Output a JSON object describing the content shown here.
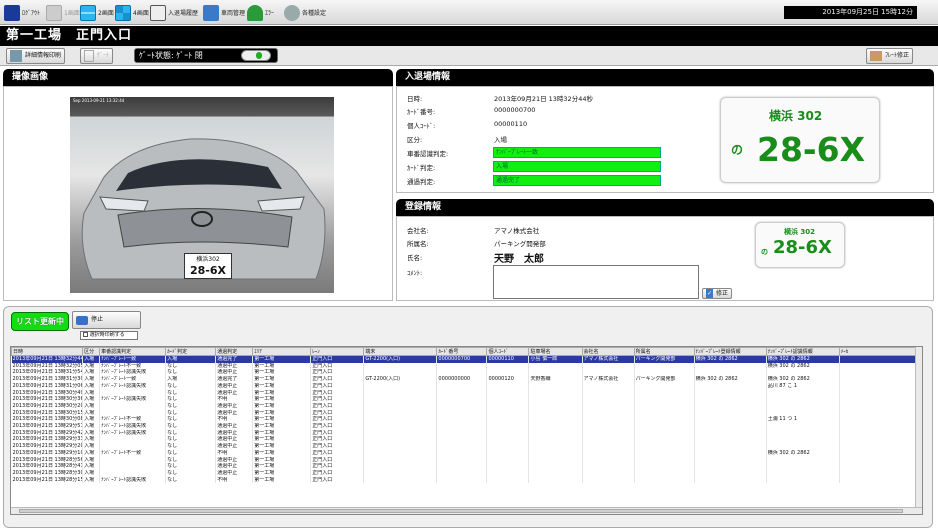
{
  "toolbar": {
    "items": [
      "ﾛｸﾞｱｳﾄ",
      "1画面",
      "2画面",
      "4画面",
      "入退場履歴",
      "車両管理",
      "ｴﾗｰ",
      "各種設定"
    ],
    "datetime": "2013年09月25日 15時12分"
  },
  "title": "第一工場　正門入口",
  "subbar": {
    "print_label": "詳細情報印刷",
    "gate_label": "ｹﾞｰﾄ",
    "gate_status": "ｹﾞｰﾄ状態:  ｹﾞｰﾄ 閉",
    "plate_fix_label": "ﾌﾚｰﾄ修正"
  },
  "camera": {
    "header": "撮像画像",
    "timestamp": "Sep 2013-09-21 13:32:44",
    "plate_top": "横浜302",
    "plate_main": "28-6X"
  },
  "entry": {
    "header": "入退場情報",
    "labels": [
      "日時:",
      "ｶｰﾄﾞ番号:",
      "個人ｺｰﾄﾞ:",
      "区分:",
      "車番認識判定:",
      "ｶｰﾄﾞ判定:",
      "通過判定:"
    ],
    "values": [
      "2013年09月21日 13時32分44秒",
      "0000000700",
      "00000110",
      "入場"
    ],
    "status": [
      "ﾅﾝﾊﾞｰﾌﾟﾚｰﾄ一致",
      "入場",
      "通過完了"
    ],
    "plate": {
      "hira": "の",
      "region": "横浜 302",
      "number": "28-6X"
    }
  },
  "registration": {
    "header": "登録情報",
    "labels": [
      "会社名:",
      "所属名:",
      "氏名:",
      "ｺﾒﾝﾄ:"
    ],
    "company": "アマノ株式会社",
    "department": "パーキング開発部",
    "name": "天野　太郎",
    "comment": "",
    "fix_button": "修正",
    "plate": {
      "hira": "の",
      "region": "横浜 302",
      "number": "28-6X"
    }
  },
  "list": {
    "refresh_button": "リスト更新中",
    "stop_button": "停止",
    "checkbox_label": "選択時印刷する",
    "columns": [
      "日時",
      "区分",
      "車番認識判定",
      "ｶｰﾄﾞ判定",
      "通過判定",
      "ｴﾘｱ",
      "ﾚｰﾝ",
      "端末",
      "ｶｰﾄﾞ番号",
      "個人ｺｰﾄﾞ",
      "駐車場名",
      "会社名",
      "所属名",
      "ﾅﾝﾊﾞｰﾌﾟﾚｰﾄ登録情報",
      "ﾅﾝﾊﾞｰﾌﾟﾚｰﾄ認識情報",
      "ﾒｰｶ"
    ],
    "rows": [
      [
        "2013年09月21日 13時32分44秒",
        "入場",
        "ﾅﾝﾊﾞｰﾌﾟﾚｰﾄ一致",
        "入場",
        "通過完了",
        "第一工場",
        "正門入口",
        "GT-2200(入口)",
        "0000000700",
        "00000110",
        "小島 慎一郎",
        "アマノ株式会社",
        "パーキング開発部",
        "横浜 302 の 2862",
        "横浜 302 の 2862",
        ""
      ],
      [
        "2013年09月21日 13時32分05秒",
        "入場",
        "ﾅﾝﾊﾞｰﾌﾟﾚｰﾄ不一致",
        "なし",
        "通過中止",
        "第一工場",
        "正門入口",
        "",
        "",
        "",
        "",
        "",
        "",
        "",
        "横浜 302 の 2862",
        ""
      ],
      [
        "2013年09月21日 13時31分54秒",
        "入場",
        "ﾅﾝﾊﾞｰﾌﾟﾚｰﾄ認識失敗",
        "なし",
        "通過中止",
        "第一工場",
        "正門入口",
        "",
        "",
        "",
        "",
        "",
        "",
        "",
        "",
        ""
      ],
      [
        "2013年09月21日 13時31分30秒",
        "入場",
        "ﾅﾝﾊﾞｰﾌﾟﾚｰﾄ一致",
        "入場",
        "通過完了",
        "第一工場",
        "正門入口",
        "GT-2200(入口)",
        "0000000000",
        "00000120",
        "天野香織",
        "アマノ株式会社",
        "パーキング開発部",
        "横浜 302 の 2862",
        "横浜 302 の 2862",
        ""
      ],
      [
        "2013年09月21日 13時31分06秒",
        "入場",
        "ﾅﾝﾊﾞｰﾌﾟﾚｰﾄ認識失敗",
        "なし",
        "通過中止",
        "第一工場",
        "正門入口",
        "",
        "",
        "",
        "",
        "",
        "",
        "",
        "品川 87 こ 1",
        ""
      ],
      [
        "2013年09月21日 13時30分49秒",
        "入場",
        "",
        "なし",
        "通過中止",
        "第一工場",
        "正門入口",
        "",
        "",
        "",
        "",
        "",
        "",
        "",
        "",
        ""
      ],
      [
        "2013年09月21日 13時30分36秒",
        "入場",
        "ﾅﾝﾊﾞｰﾌﾟﾚｰﾄ認識失敗",
        "なし",
        "不明",
        "第一工場",
        "正門入口",
        "",
        "",
        "",
        "",
        "",
        "",
        "",
        "",
        ""
      ],
      [
        "2013年09月21日 13時30分20秒",
        "入場",
        "",
        "なし",
        "通過中止",
        "第一工場",
        "正門入口",
        "",
        "",
        "",
        "",
        "",
        "",
        "",
        "",
        ""
      ],
      [
        "2013年09月21日 13時30分15秒",
        "入場",
        "",
        "なし",
        "通過中止",
        "第一工場",
        "正門入口",
        "",
        "",
        "",
        "",
        "",
        "",
        "",
        "",
        ""
      ],
      [
        "2013年09月21日 13時30分08秒",
        "入場",
        "ﾅﾝﾊﾞｰﾌﾟﾚｰﾄ不一致",
        "なし",
        "不明",
        "第一工場",
        "正門入口",
        "",
        "",
        "",
        "",
        "",
        "",
        "",
        "土浦 11 つ 1",
        ""
      ],
      [
        "2013年09月21日 13時29分57秒",
        "入場",
        "ﾅﾝﾊﾞｰﾌﾟﾚｰﾄ認識失敗",
        "なし",
        "通過中止",
        "第一工場",
        "正門入口",
        "",
        "",
        "",
        "",
        "",
        "",
        "",
        "",
        ""
      ],
      [
        "2013年09月21日 13時29分42秒",
        "入場",
        "ﾅﾝﾊﾞｰﾌﾟﾚｰﾄ認識失敗",
        "なし",
        "通過中止",
        "第一工場",
        "正門入口",
        "",
        "",
        "",
        "",
        "",
        "",
        "",
        "",
        ""
      ],
      [
        "2013年09月21日 13時29分33秒",
        "入場",
        "",
        "なし",
        "通過中止",
        "第一工場",
        "正門入口",
        "",
        "",
        "",
        "",
        "",
        "",
        "",
        "",
        ""
      ],
      [
        "2013年09月21日 13時29分20秒",
        "入場",
        "",
        "なし",
        "通過中止",
        "第一工場",
        "正門入口",
        "",
        "",
        "",
        "",
        "",
        "",
        "",
        "",
        ""
      ],
      [
        "2013年09月21日 13時29分10秒",
        "入場",
        "ﾅﾝﾊﾞｰﾌﾟﾚｰﾄ不一致",
        "なし",
        "不明",
        "第一工場",
        "正門入口",
        "",
        "",
        "",
        "",
        "",
        "",
        "",
        "横浜 302 の 2862",
        ""
      ],
      [
        "2013年09月21日 13時28分56秒",
        "入場",
        "",
        "なし",
        "通過中止",
        "第一工場",
        "正門入口",
        "",
        "",
        "",
        "",
        "",
        "",
        "",
        "",
        ""
      ],
      [
        "2013年09月21日 13時28分41秒",
        "入場",
        "",
        "なし",
        "通過中止",
        "第一工場",
        "正門入口",
        "",
        "",
        "",
        "",
        "",
        "",
        "",
        "",
        ""
      ],
      [
        "2013年09月21日 13時28分30秒",
        "入場",
        "",
        "なし",
        "通過中止",
        "第一工場",
        "正門入口",
        "",
        "",
        "",
        "",
        "",
        "",
        "",
        "",
        ""
      ],
      [
        "2013年09月21日 13時28分15秒",
        "入場",
        "ﾅﾝﾊﾞｰﾌﾟﾚｰﾄ認識失敗",
        "なし",
        "不明",
        "第一工場",
        "正門入口",
        "",
        "",
        "",
        "",
        "",
        "",
        "",
        "",
        ""
      ]
    ]
  },
  "colors": {
    "accent": "#000000",
    "ok": "#11ee11",
    "selected": "#2a3a9e",
    "plate_text": "#1a8c1a"
  }
}
